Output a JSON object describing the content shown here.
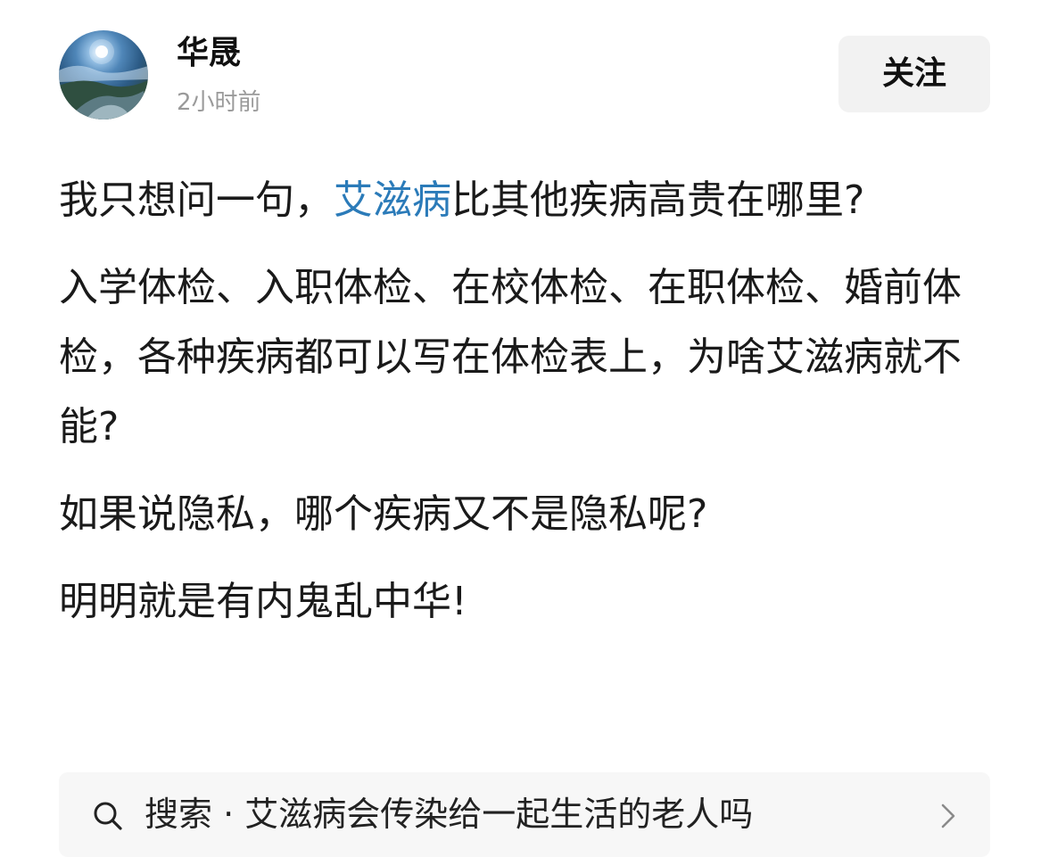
{
  "post": {
    "author": {
      "name": "华晟",
      "time": "2小时前",
      "avatar_icon": "moonlit-landscape-avatar"
    },
    "follow_label": "关注",
    "paragraphs": [
      {
        "before": "我只想问一句，",
        "link": "艾滋病",
        "after": "比其他疾病高贵在哪里?"
      },
      {
        "text": "入学体检、入职体检、在校体检、在职体检、婚前体检，各种疾病都可以写在体检表上，为啥艾滋病就不能?"
      },
      {
        "text": "如果说隐私，哪个疾病又不是隐私呢?"
      },
      {
        "text": "明明就是有内鬼乱中华!"
      }
    ],
    "topic_link_color": "#2b7bb9"
  },
  "search_suggestion": {
    "icon": "search-icon",
    "text": "搜索 · 艾滋病会传染给一起生活的老人吗",
    "chevron_icon": "chevron-right-icon"
  }
}
